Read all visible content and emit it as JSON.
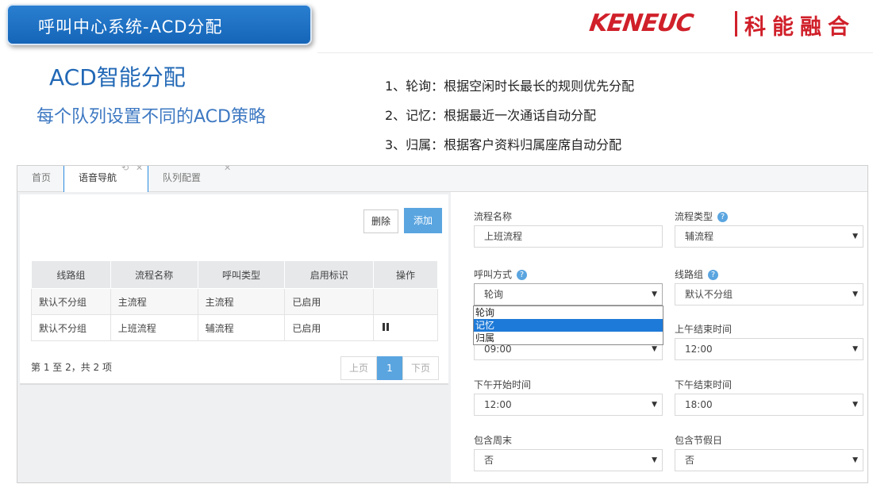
{
  "slide": {
    "banner_title": "呼叫中心系统-ACD分配",
    "brand_latin": "KENEUC",
    "brand_cn": "科能融合",
    "main_title": "ACD智能分配",
    "subtitle": "每个队列设置不同的ACD策略",
    "strategies": [
      "1、轮询：根据空闲时长最长的规则优先分配",
      "2、记忆：根据最近一次通话自动分配",
      "3、归属：根据客户资料归属座席自动分配"
    ]
  },
  "tabs": [
    {
      "label": "首页"
    },
    {
      "label": "语音导航"
    },
    {
      "label": "队列配置"
    }
  ],
  "toolbar": {
    "delete_label": "删除",
    "add_label": "添加"
  },
  "table": {
    "columns": [
      "线路组",
      "流程名称",
      "呼叫类型",
      "启用标识",
      "操作"
    ],
    "rows": [
      [
        "默认不分组",
        "主流程",
        "主流程",
        "已启用",
        ""
      ],
      [
        "默认不分组",
        "上班流程",
        "辅流程",
        "已启用",
        "pause-icon"
      ]
    ]
  },
  "pager": {
    "info": "第 1 至 2，共 2 项",
    "prev": "上页",
    "current": "1",
    "next": "下页"
  },
  "form": {
    "flow_name": {
      "label": "流程名称",
      "value": "上班流程"
    },
    "flow_type": {
      "label": "流程类型",
      "value": "辅流程"
    },
    "call_mode": {
      "label": "呼叫方式",
      "value": "轮询",
      "options": [
        "轮询",
        "记忆",
        "归属"
      ],
      "highlighted": "记忆"
    },
    "line_group": {
      "label": "线路组",
      "value": "默认不分组"
    },
    "am_start": {
      "value": "09:00"
    },
    "am_end": {
      "label": "上午结束时间",
      "value": "12:00"
    },
    "pm_start": {
      "label": "下午开始时间",
      "value": "12:00"
    },
    "pm_end": {
      "label": "下午结束时间",
      "value": "18:00"
    },
    "weekend": {
      "label": "包含周末",
      "value": "否"
    },
    "holiday": {
      "label": "包含节假日",
      "value": "否"
    }
  },
  "colors": {
    "accent": "#5aa5e0",
    "brand": "#d0202a",
    "banner": "#1565b8"
  }
}
